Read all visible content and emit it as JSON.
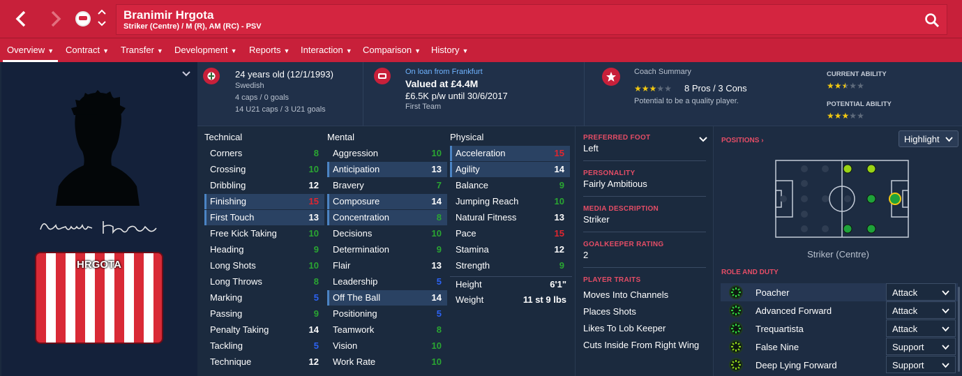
{
  "window": {
    "player_name": "Branimir Hrgota",
    "player_subtitle": "Striker (Centre) / M (R), AM (RC) - PSV"
  },
  "tabs": [
    {
      "label": "Overview",
      "active": true
    },
    {
      "label": "Contract"
    },
    {
      "label": "Transfer"
    },
    {
      "label": "Development"
    },
    {
      "label": "Reports"
    },
    {
      "label": "Interaction"
    },
    {
      "label": "Comparison"
    },
    {
      "label": "History"
    }
  ],
  "profile": {
    "signature": "Branimir Hrgota",
    "shirt_name": "HRGOTA"
  },
  "header": {
    "age": "24 years old (12/1/1993)",
    "nationality": "Swedish",
    "caps": "4 caps / 0 goals",
    "u21_caps": "14 U21 caps / 3 U21 goals",
    "loan_status": "On loan from Frankfurt",
    "value": "Valued at £4.4M",
    "wage": "£6.5K p/w until 30/6/2017",
    "squad": "First Team",
    "coach_summary_title": "Coach Summary",
    "pros_cons": "8 Pros / 3 Cons",
    "potential_note": "Potential to be a quality player.",
    "current_ability_label": "CURRENT ABILITY",
    "potential_ability_label": "POTENTIAL ABILITY",
    "coach_stars": 3,
    "current_ability_stars": 2.5,
    "potential_ability_stars": 3
  },
  "technical": {
    "title": "Technical",
    "rows": [
      {
        "label": "Corners",
        "value": "8"
      },
      {
        "label": "Crossing",
        "value": "10"
      },
      {
        "label": "Dribbling",
        "value": "12"
      },
      {
        "label": "Finishing",
        "value": "15"
      },
      {
        "label": "First Touch",
        "value": "13"
      },
      {
        "label": "Free Kick Taking",
        "value": "10"
      },
      {
        "label": "Heading",
        "value": "9"
      },
      {
        "label": "Long Shots",
        "value": "10"
      },
      {
        "label": "Long Throws",
        "value": "8"
      },
      {
        "label": "Marking",
        "value": "5"
      },
      {
        "label": "Passing",
        "value": "9"
      },
      {
        "label": "Penalty Taking",
        "value": "14"
      },
      {
        "label": "Tackling",
        "value": "5"
      },
      {
        "label": "Technique",
        "value": "12"
      }
    ]
  },
  "mental": {
    "title": "Mental",
    "rows": [
      {
        "label": "Aggression",
        "value": "10"
      },
      {
        "label": "Anticipation",
        "value": "13"
      },
      {
        "label": "Bravery",
        "value": "7"
      },
      {
        "label": "Composure",
        "value": "14"
      },
      {
        "label": "Concentration",
        "value": "8"
      },
      {
        "label": "Decisions",
        "value": "10"
      },
      {
        "label": "Determination",
        "value": "9"
      },
      {
        "label": "Flair",
        "value": "13"
      },
      {
        "label": "Leadership",
        "value": "5"
      },
      {
        "label": "Off The Ball",
        "value": "14"
      },
      {
        "label": "Positioning",
        "value": "5"
      },
      {
        "label": "Teamwork",
        "value": "8"
      },
      {
        "label": "Vision",
        "value": "10"
      },
      {
        "label": "Work Rate",
        "value": "10"
      }
    ]
  },
  "physical": {
    "title": "Physical",
    "rows": [
      {
        "label": "Acceleration",
        "value": "15"
      },
      {
        "label": "Agility",
        "value": "14"
      },
      {
        "label": "Balance",
        "value": "9"
      },
      {
        "label": "Jumping Reach",
        "value": "10"
      },
      {
        "label": "Natural Fitness",
        "value": "13"
      },
      {
        "label": "Pace",
        "value": "15"
      },
      {
        "label": "Stamina",
        "value": "12"
      },
      {
        "label": "Strength",
        "value": "9"
      }
    ],
    "height_label": "Height",
    "height": "6'1\"",
    "weight_label": "Weight",
    "weight": "11 st 9 lbs"
  },
  "info": {
    "preferred_foot_title": "PREFERRED FOOT",
    "preferred_foot": "Left",
    "personality_title": "PERSONALITY",
    "personality": "Fairly Ambitious",
    "media_title": "MEDIA DESCRIPTION",
    "media": "Striker",
    "gk_title": "GOALKEEPER RATING",
    "gk": "2",
    "traits_title": "PLAYER TRAITS",
    "traits": [
      "Moves Into Channels",
      "Places Shots",
      "Likes To Lob Keeper",
      "Cuts Inside From Right Wing"
    ]
  },
  "positions": {
    "title": "POSITIONS",
    "highlight_label": "Highlight",
    "position_label": "Striker (Centre)",
    "role_title": "ROLE AND DUTY",
    "roles": [
      {
        "name": "Poacher",
        "duty": "Attack"
      },
      {
        "name": "Advanced Forward",
        "duty": "Attack"
      },
      {
        "name": "Trequartista",
        "duty": "Attack"
      },
      {
        "name": "False Nine",
        "duty": "Support"
      },
      {
        "name": "Deep Lying Forward",
        "duty": "Support"
      }
    ]
  },
  "colors": {
    "accent": "#c8203a",
    "green": "#2aa632",
    "red": "#e0262f",
    "blue": "#2c62f2",
    "star": "#f2c811"
  },
  "icons": {
    "back": "chevron-left-icon",
    "forward": "chevron-right-icon",
    "search": "search-icon",
    "club": "psv-crest-icon",
    "nation": "nation-flag-icon",
    "loan": "loan-club-crest-icon",
    "coach": "star-badge-icon"
  }
}
